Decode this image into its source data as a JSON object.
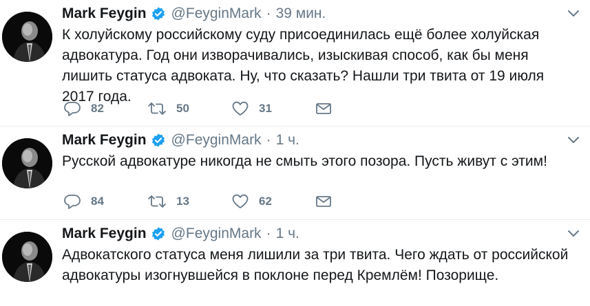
{
  "tweets": [
    {
      "name": "Mark Feygin",
      "handle": "@FeyginMark",
      "time": "39 мин.",
      "text": "К холуйскому российскому суду присоединилась ещё более холуйская адвокатура. Год они изворачивались, изыскивая способ, как бы меня лишить статуса адвоката. Ну, что сказать? Нашли три твита от 19 июля 2017 года.",
      "replies": "82",
      "retweets": "50",
      "likes": "31"
    },
    {
      "name": "Mark Feygin",
      "handle": "@FeyginMark",
      "time": "1 ч.",
      "text": "Русской адвокатуре никогда не смыть этого позора. Пусть живут с этим!",
      "replies": "84",
      "retweets": "13",
      "likes": "62"
    },
    {
      "name": "Mark Feygin",
      "handle": "@FeyginMark",
      "time": "1 ч.",
      "text": "Адвокатского статуса меня лишили за три твита. Чего ждать от российской адвокатуры изогнувшейся в поклоне перед Кремлём! Позорище."
    }
  ],
  "separator": "·",
  "colors": {
    "text": "#14171a",
    "secondary": "#657786",
    "verified": "#1da1f2",
    "border": "#e6ecf0"
  },
  "icons": [
    "verified-badge-icon",
    "chevron-down-icon",
    "reply-icon",
    "retweet-icon",
    "like-icon",
    "direct-message-icon"
  ]
}
